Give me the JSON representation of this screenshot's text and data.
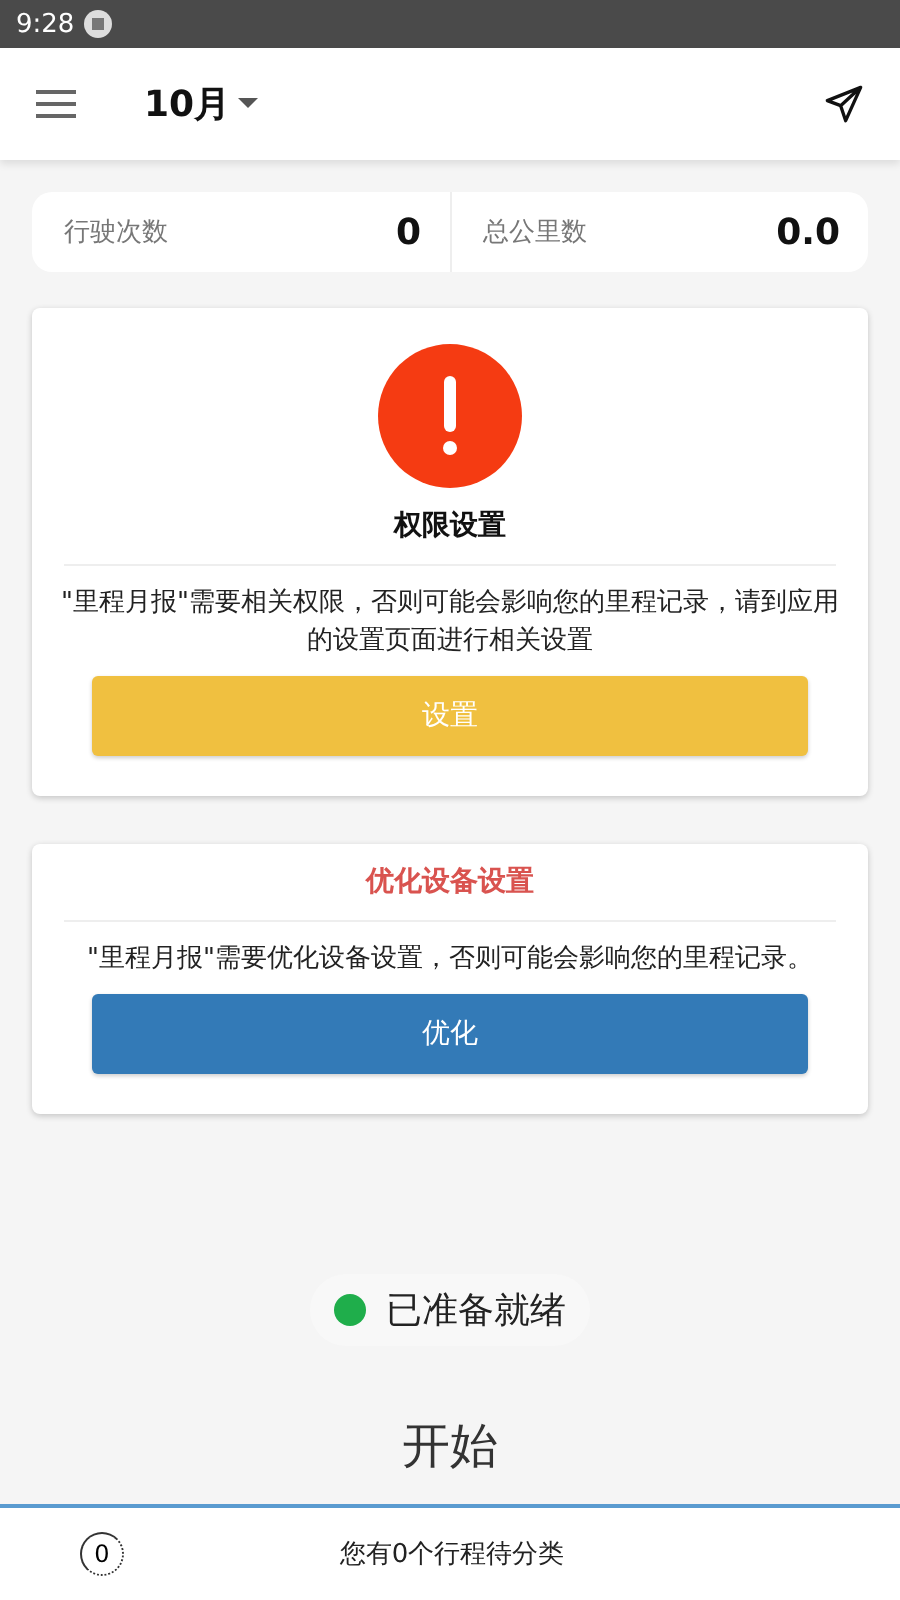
{
  "status_bar": {
    "time": "9:28"
  },
  "app_bar": {
    "month": "10月"
  },
  "stats": [
    {
      "label": "行驶次数",
      "value": "0"
    },
    {
      "label": "总公里数",
      "value": "0.0"
    }
  ],
  "cards": [
    {
      "kind": "alert",
      "title": "权限设置",
      "message": "\"里程月报\"需要相关权限，否则可能会影响您的里程记录，请到应用的设置页面进行相关设置",
      "button": "设置"
    },
    {
      "kind": "plain",
      "title": "优化设备设置",
      "message": "\"里程月报\"需要优化设备设置，否则可能会影响您的里程记录。",
      "button": "优化"
    }
  ],
  "status": {
    "label": "已准备就绪",
    "color": "#1fae4b"
  },
  "start_label": "开始",
  "bottom_bar": {
    "count": "0",
    "text": "您有0个行程待分类"
  }
}
